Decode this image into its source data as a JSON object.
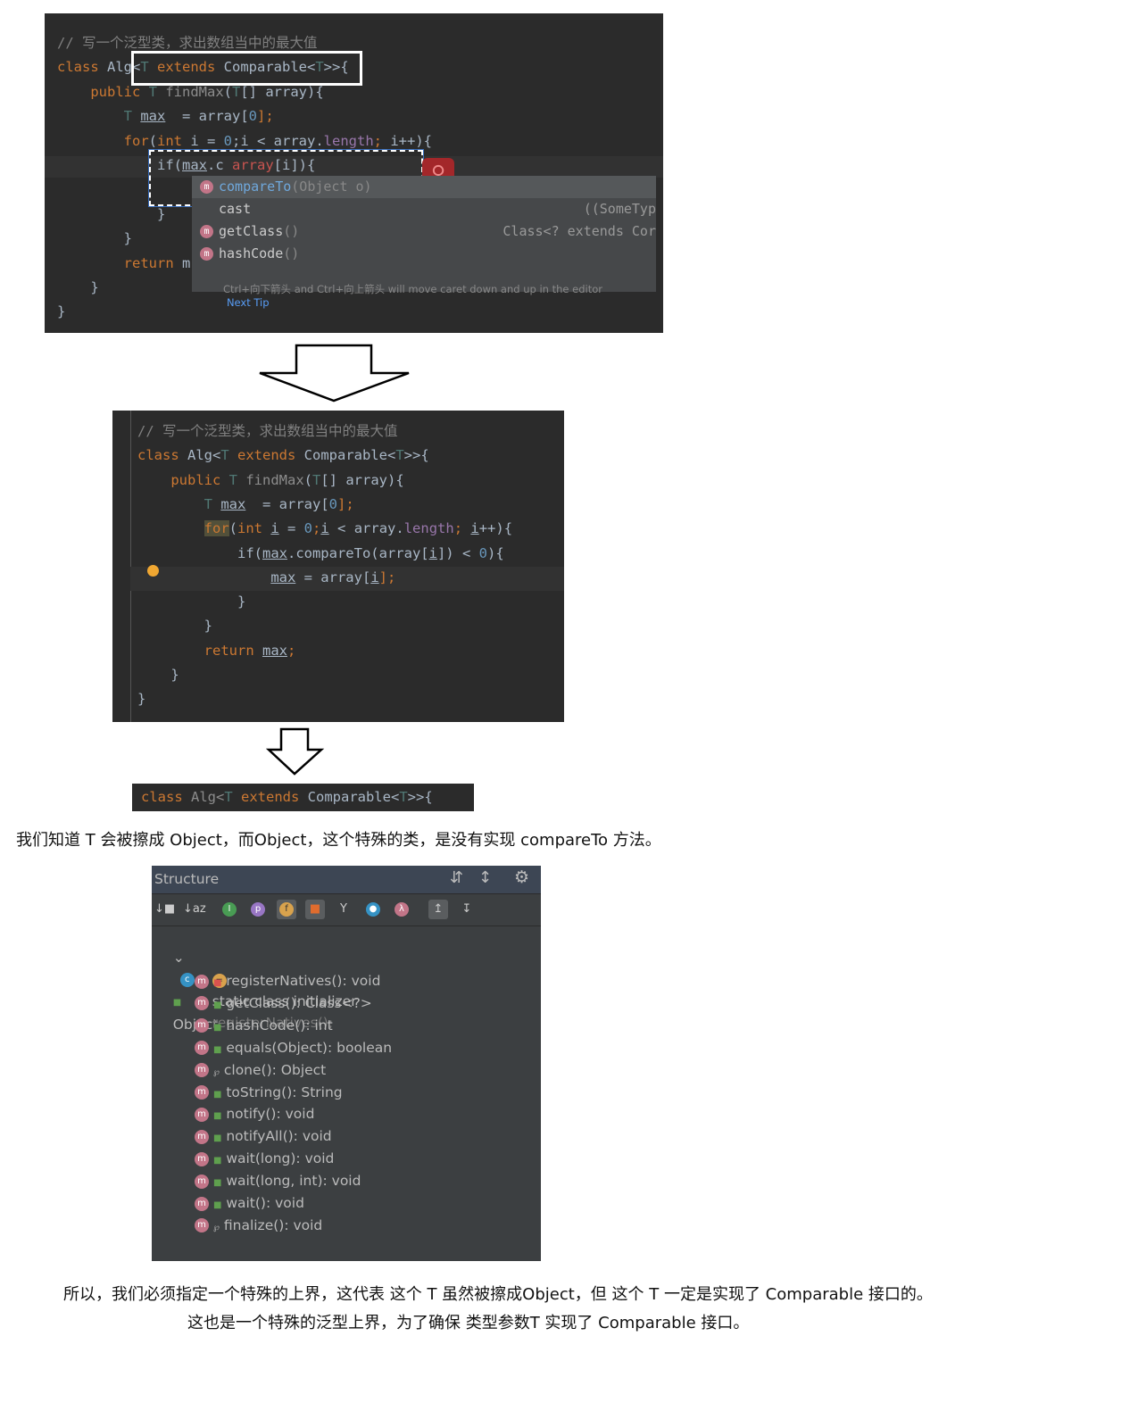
{
  "block1": {
    "lines": [
      [
        [
          "// 写一个泛型类，求出数组当中的最大值",
          "cm"
        ]
      ],
      [
        [
          "class ",
          "kw"
        ],
        [
          "Alg",
          ""
        ],
        [
          "<",
          ""
        ],
        [
          "T ",
          "ty"
        ],
        [
          "extends ",
          "kw"
        ],
        [
          "Comparable<",
          ""
        ],
        [
          "T",
          "ty"
        ],
        [
          ">>{",
          ""
        ]
      ],
      [
        [
          "    public ",
          "kw"
        ],
        [
          "T ",
          "ty"
        ],
        [
          "findMax",
          "fn"
        ],
        [
          "(",
          ""
        ],
        [
          "T",
          "ty"
        ],
        [
          "[] array){",
          ""
        ]
      ],
      [
        [
          "        T ",
          "ty"
        ],
        [
          "max",
          "ul"
        ],
        [
          "  = array[",
          ""
        ],
        [
          "0",
          "num"
        ],
        [
          "];",
          "kw"
        ]
      ],
      [
        [
          "        for",
          "kw"
        ],
        [
          "(",
          ""
        ],
        [
          "int ",
          "kw"
        ],
        [
          "i = ",
          ""
        ],
        [
          "0",
          "num"
        ],
        [
          ";i < array.",
          ""
        ],
        [
          "length",
          "pf"
        ],
        [
          "; ",
          "kw"
        ],
        [
          "i++){",
          ""
        ]
      ],
      [
        [
          "            if(",
          ""
        ],
        [
          "max",
          "ul"
        ],
        [
          ".c",
          ""
        ],
        [
          " array",
          "red"
        ],
        [
          "[i]){",
          ""
        ]
      ],
      [
        [
          "",
          ""
        ]
      ],
      [
        [
          "            }",
          ""
        ]
      ],
      [
        [
          "        }",
          ""
        ]
      ],
      [
        [
          "        return ",
          "kw"
        ],
        [
          "m",
          ""
        ]
      ],
      [
        [
          "    }",
          ""
        ]
      ],
      [
        [
          "}",
          ""
        ]
      ]
    ],
    "popup": {
      "items": [
        {
          "name": "compareTo",
          "sig": "(Object o)",
          "type": "",
          "icon": "method-icon"
        },
        {
          "name": "cast",
          "sig": "",
          "type": "((SomeTyp",
          "icon": ""
        },
        {
          "name": "getClass",
          "sig": "()",
          "type": "Class<? extends Cor",
          "icon": "method-icon"
        },
        {
          "name": "hashCode",
          "sig": "()",
          "type": "",
          "icon": "method-icon"
        }
      ],
      "tip": "Ctrl+向下箭头 and Ctrl+向上箭头 will move caret down and up in the editor",
      "next_tip": "Next Tip"
    }
  },
  "block2": {
    "lines": [
      [
        [
          "// 写一个泛型类，求出数组当中的最大值",
          "cm"
        ]
      ],
      [
        [
          "class ",
          "kw"
        ],
        [
          "Alg<",
          ""
        ],
        [
          "T ",
          "ty"
        ],
        [
          "extends ",
          "kw"
        ],
        [
          "Comparable<",
          ""
        ],
        [
          "T",
          "ty"
        ],
        [
          ">>{",
          ""
        ]
      ],
      [
        [
          "    public ",
          "kw"
        ],
        [
          "T ",
          "ty"
        ],
        [
          "findMax",
          "fn"
        ],
        [
          "(",
          ""
        ],
        [
          "T",
          "ty"
        ],
        [
          "[] array){",
          ""
        ]
      ],
      [
        [
          "        T ",
          "ty"
        ],
        [
          "max",
          "ul"
        ],
        [
          "  = array[",
          ""
        ],
        [
          "0",
          "num"
        ],
        [
          "];",
          "kw"
        ]
      ],
      [
        [
          "        ",
          ""
        ],
        [
          "for",
          "kw hl"
        ],
        [
          "(",
          ""
        ],
        [
          "int ",
          "kw"
        ],
        [
          "i",
          "ul"
        ],
        [
          " = ",
          ""
        ],
        [
          "0",
          "num"
        ],
        [
          ";",
          "kw"
        ],
        [
          "i",
          "ul"
        ],
        [
          " < array.",
          ""
        ],
        [
          "length",
          "pf"
        ],
        [
          "; ",
          "kw"
        ],
        [
          "i",
          "ul"
        ],
        [
          "++){",
          ""
        ]
      ],
      [
        [
          "            if(",
          ""
        ],
        [
          "max",
          "ul"
        ],
        [
          ".compareTo(array[",
          ""
        ],
        [
          "i",
          "ul"
        ],
        [
          "]) < ",
          ""
        ],
        [
          "0",
          "num"
        ],
        [
          "){",
          ""
        ]
      ],
      [
        [
          "                ",
          ""
        ],
        [
          "max",
          "ul"
        ],
        [
          " = array[",
          ""
        ],
        [
          "i",
          "ul"
        ],
        [
          "];",
          "kw"
        ]
      ],
      [
        [
          "            }",
          ""
        ]
      ],
      [
        [
          "        }",
          ""
        ]
      ],
      [
        [
          "        return ",
          "kw"
        ],
        [
          "max",
          "ul"
        ],
        [
          ";",
          "kw"
        ]
      ],
      [
        [
          "    }",
          ""
        ]
      ],
      [
        [
          "}",
          ""
        ]
      ]
    ]
  },
  "block3": {
    "lines": [
      [
        [
          "class ",
          "kw"
        ],
        [
          "Alg<",
          "fn"
        ],
        [
          "T ",
          "ty"
        ],
        [
          "extends ",
          "kw"
        ],
        [
          "Comparable<",
          ""
        ],
        [
          "T",
          "ty"
        ],
        [
          ">>{",
          ""
        ]
      ]
    ]
  },
  "text1": "我们知道 T 会被擦成 Object，而Object，这个特殊的类，是没有实现 compareTo 方法。",
  "structure": {
    "title": "Structure",
    "root": "Object",
    "initializer": {
      "label": "static class initializer",
      "detail": "registerNatives();"
    },
    "items": [
      {
        "label": "registerNatives(): void",
        "access": "private"
      },
      {
        "label": "getClass(): Class<?>",
        "access": "public"
      },
      {
        "label": "hashCode(): int",
        "access": "public"
      },
      {
        "label": "equals(Object): boolean",
        "access": "public"
      },
      {
        "label": "clone(): Object",
        "access": "protected"
      },
      {
        "label": "toString(): String",
        "access": "public"
      },
      {
        "label": "notify(): void",
        "access": "public"
      },
      {
        "label": "notifyAll(): void",
        "access": "public"
      },
      {
        "label": "wait(long): void",
        "access": "public"
      },
      {
        "label": "wait(long, int): void",
        "access": "public"
      },
      {
        "label": "wait(): void",
        "access": "public"
      },
      {
        "label": "finalize(): void",
        "access": "protected"
      }
    ]
  },
  "text2": "所以，我们必须指定一个特殊的上界，这代表 这个 T 虽然被擦成Object，但 这个 T 一定是实现了 Comparable 接口的。",
  "text3": "这也是一个特殊的泛型上界，为了确保 类型参数T 实现了 Comparable 接口。"
}
